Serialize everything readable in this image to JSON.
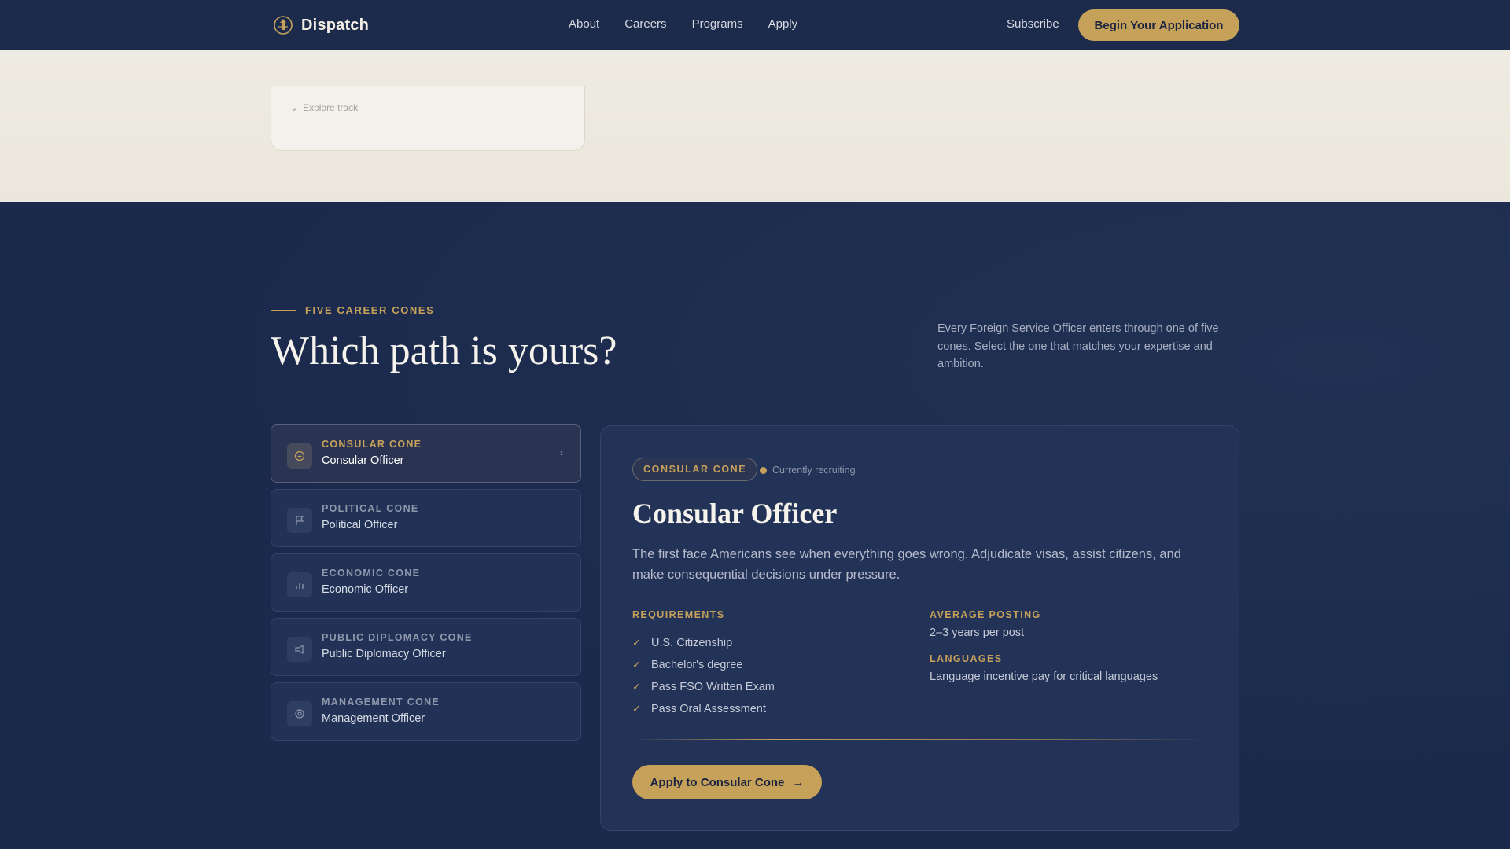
{
  "header": {
    "brand": "Dispatch",
    "nav": [
      "About",
      "Careers",
      "Programs",
      "Apply"
    ],
    "subscribe": "Subscribe",
    "cta": "Begin Your Application"
  },
  "track_card": {
    "explore": "Explore track"
  },
  "section": {
    "eyebrow": "FIVE CAREER CONES",
    "headline": "Which path is yours?",
    "intro": "Every Foreign Service Officer enters through one of five cones. Select the one that matches your expertise and ambition."
  },
  "cones": [
    {
      "kind": "CONSULAR CONE",
      "title": "Consular Officer",
      "icon": "clock-icon",
      "active": true
    },
    {
      "kind": "POLITICAL CONE",
      "title": "Political Officer",
      "icon": "flag-icon",
      "active": false
    },
    {
      "kind": "ECONOMIC CONE",
      "title": "Economic Officer",
      "icon": "bar-chart-icon",
      "active": false
    },
    {
      "kind": "PUBLIC DIPLOMACY CONE",
      "title": "Public Diplomacy Officer",
      "icon": "megaphone-icon",
      "active": false
    },
    {
      "kind": "MANAGEMENT CONE",
      "title": "Management Officer",
      "icon": "target-icon",
      "active": false
    }
  ],
  "detail": {
    "badge": "CONSULAR CONE",
    "status": "Currently recruiting",
    "title": "Consular Officer",
    "description": "The first face Americans see when everything goes wrong. Adjudicate visas, assist citizens, and make consequential decisions under pressure.",
    "requirements_heading": "REQUIREMENTS",
    "requirements": [
      "U.S. Citizenship",
      "Bachelor's degree",
      "Pass FSO Written Exam",
      "Pass Oral Assessment"
    ],
    "posting_heading": "AVERAGE POSTING",
    "posting_value": "2–3 years per post",
    "languages_heading": "LANGUAGES",
    "languages_value": "Language incentive pay for critical languages",
    "apply_label": "Apply to Consular Cone"
  },
  "colors": {
    "navy": "#1b2a4c",
    "gold": "#c6a15a",
    "cream": "#ece8de"
  }
}
